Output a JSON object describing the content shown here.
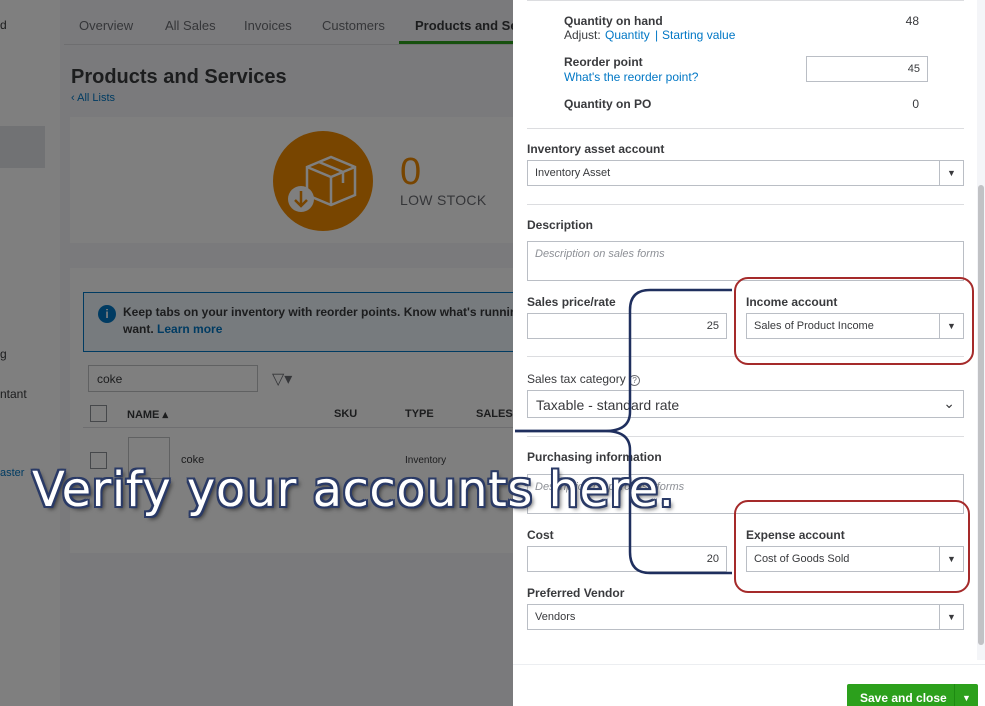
{
  "leftnav": {
    "items": [
      "d",
      "g",
      "ntant",
      "aster"
    ]
  },
  "tabs": [
    "Overview",
    "All Sales",
    "Invoices",
    "Customers",
    "Products and Ser"
  ],
  "page": {
    "title": "Products and Services",
    "back_link": "‹ All Lists"
  },
  "stock": {
    "count": "0",
    "label": "LOW STOCK"
  },
  "banner": {
    "text": "Keep tabs on your inventory with reorder points. Know what's running l want.",
    "link": "Learn more"
  },
  "list": {
    "search_value": "coke",
    "columns": [
      "NAME ▴",
      "SKU",
      "TYPE",
      "SALES D"
    ],
    "rows": [
      {
        "name": "coke",
        "type": "Inventory"
      }
    ]
  },
  "drawer": {
    "qty_on_hand_label": "Quantity on hand",
    "qty_on_hand_value": "48",
    "adjust_label": "Adjust:",
    "adjust_qty_link": "Quantity",
    "adjust_sep": "|",
    "adjust_start_link": "Starting value",
    "reorder_label": "Reorder point",
    "reorder_help_link": "What's the reorder point?",
    "reorder_value": "45",
    "qty_po_label": "Quantity on PO",
    "qty_po_value": "0",
    "inv_asset_label": "Inventory asset account",
    "inv_asset_value": "Inventory Asset",
    "description_label": "Description",
    "description_placeholder": "Description on sales forms",
    "sales_price_label": "Sales price/rate",
    "sales_price_value": "25",
    "income_account_label": "Income account",
    "income_account_value": "Sales of Product Income",
    "sales_tax_label": "Sales tax category",
    "sales_tax_value": "Taxable - standard rate",
    "purchasing_label": "Purchasing information",
    "purchasing_placeholder": "Description on purchase forms",
    "cost_label": "Cost",
    "cost_value": "20",
    "expense_account_label": "Expense account",
    "expense_account_value": "Cost of Goods Sold",
    "vendor_label": "Preferred Vendor",
    "vendor_value": "Vendors",
    "save_label": "Save and close"
  },
  "callout": {
    "text": "Verify your accounts here."
  },
  "colors": {
    "accent_green": "#2ca01c",
    "link_blue": "#0077c5",
    "stock_orange": "#f08a00",
    "highlight_red": "#a52a2a",
    "brace_navy": "#1f2f5e"
  }
}
